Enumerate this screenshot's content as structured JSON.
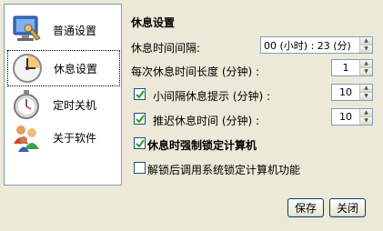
{
  "sidebar": {
    "items": [
      {
        "label": "普通设置",
        "icon": "general-settings-icon"
      },
      {
        "label": "休息设置",
        "icon": "clock-icon",
        "selected": true
      },
      {
        "label": "定时关机",
        "icon": "stopwatch-icon"
      },
      {
        "label": "关于软件",
        "icon": "users-icon"
      }
    ]
  },
  "rest": {
    "title": "休息设置",
    "interval": {
      "label": "休息时间间隔:",
      "value": "00 (小时) : 23 (分)"
    },
    "duration": {
      "label": "每次休息时间长度 (分钟) :",
      "value": "1"
    },
    "interval_reminder": {
      "label": "小间隔休息提示 (分钟) :",
      "value": "10",
      "checked": true
    },
    "postpone": {
      "label": "推迟休息时间 (分钟) :",
      "value": "10",
      "checked": true
    },
    "force_lock": {
      "label": "休息时强制锁定计算机",
      "checked": true
    },
    "unlock_lock": {
      "label": "解锁后调用系统锁定计算机功能",
      "checked": false
    }
  },
  "buttons": {
    "save": "保存",
    "close": "关闭"
  }
}
